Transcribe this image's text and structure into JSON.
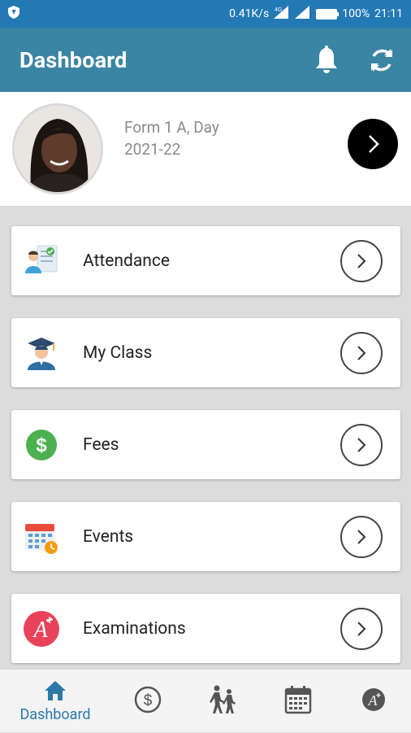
{
  "status_bar": {
    "speed": "0.41K/s",
    "battery": "100%",
    "time": "21:11"
  },
  "app_bar": {
    "title": "Dashboard",
    "notification_icon": "bell-icon",
    "refresh_icon": "refresh-icon"
  },
  "profile": {
    "class_line": "Form 1 A, Day",
    "year": "2021-22"
  },
  "menu": [
    {
      "label": "Attendance",
      "icon": "attendance-icon"
    },
    {
      "label": "My Class",
      "icon": "graduate-icon"
    },
    {
      "label": "Fees",
      "icon": "dollar-icon"
    },
    {
      "label": "Events",
      "icon": "calendar-icon"
    },
    {
      "label": "Examinations",
      "icon": "exam-icon"
    }
  ],
  "bottom_nav": {
    "active_label": "Dashboard",
    "items": [
      "home-icon",
      "dollar-icon",
      "hiking-icon",
      "calendar-icon",
      "exam-icon"
    ]
  },
  "colors": {
    "status_bar": "#2379b4",
    "app_bar": "#3a84a4",
    "accent": "#2b79a8",
    "background": "#dcdcdc"
  }
}
